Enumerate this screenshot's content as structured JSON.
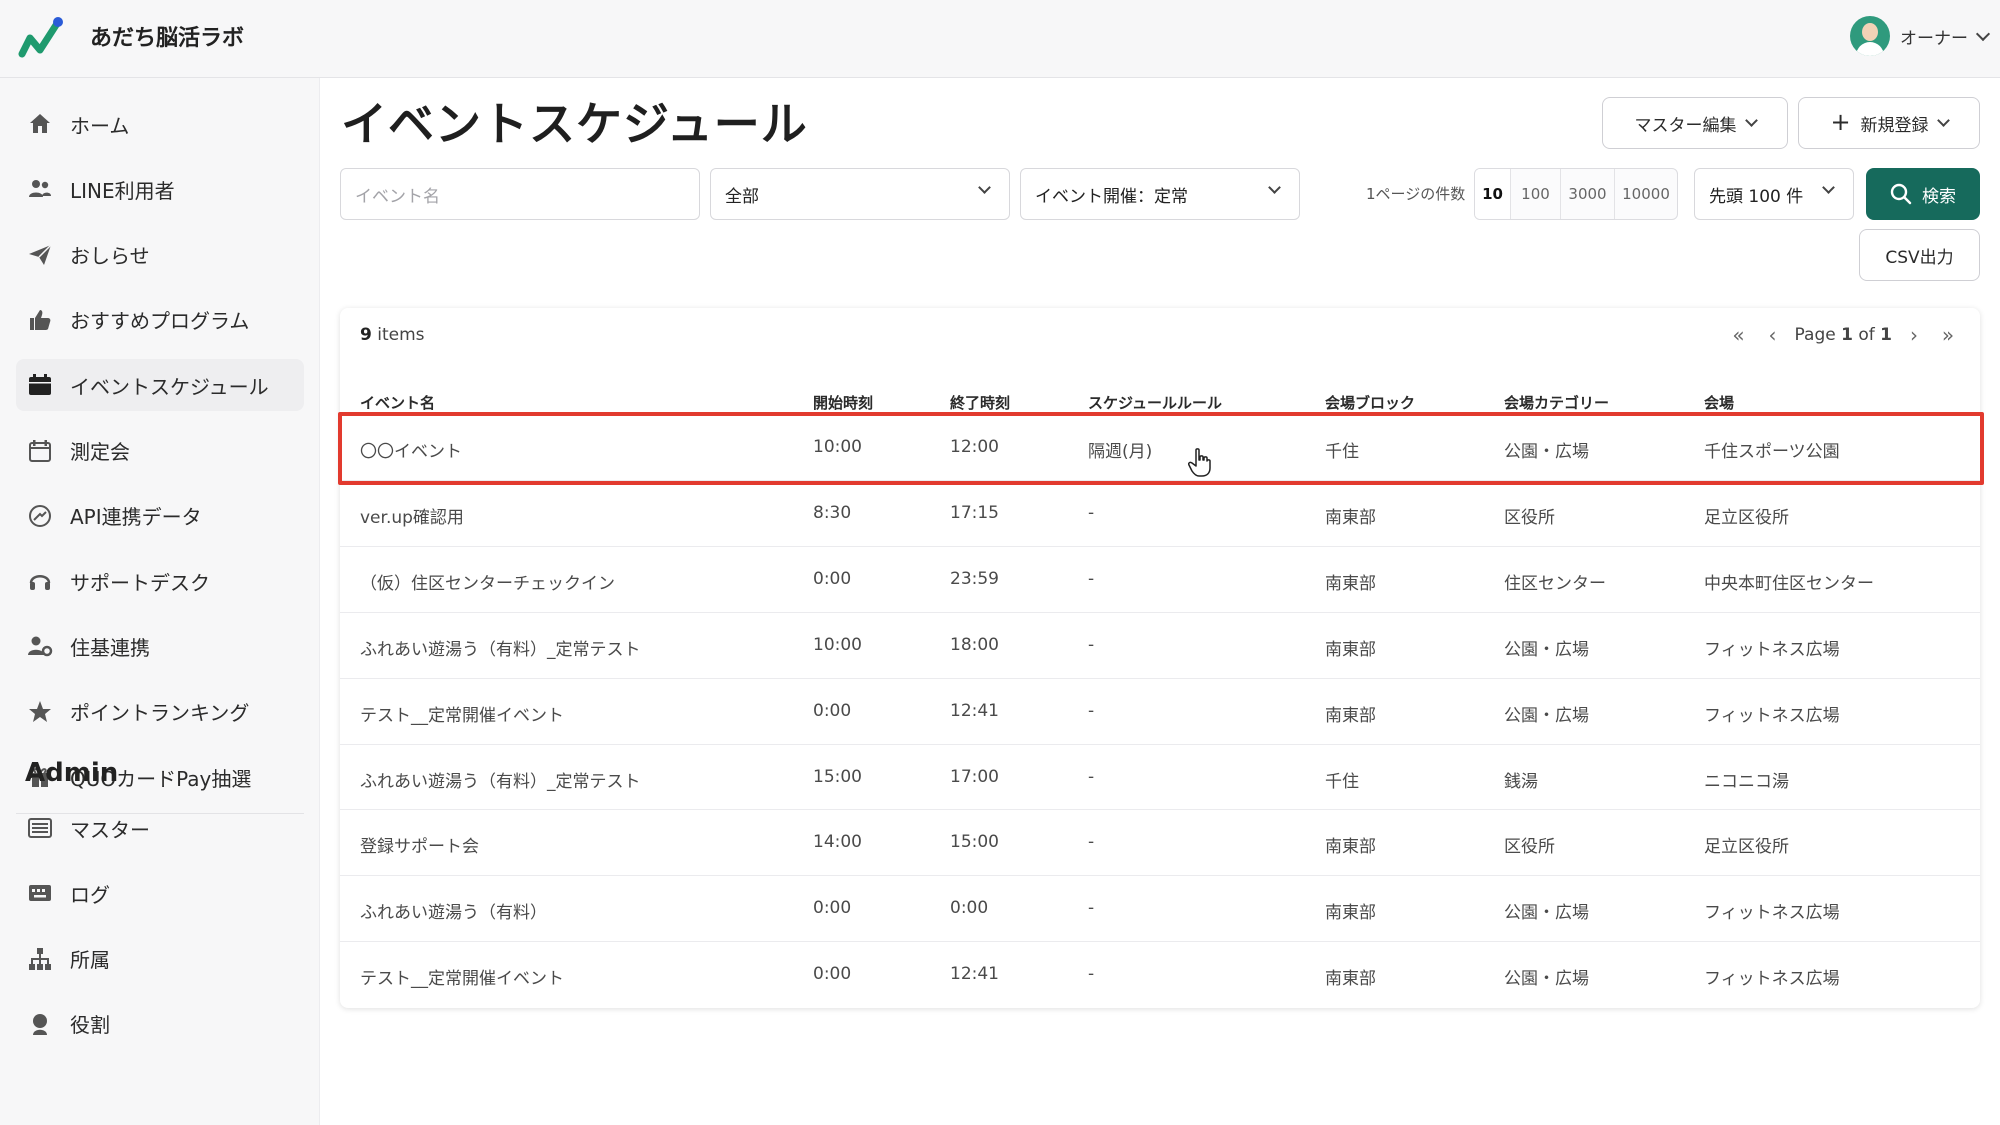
{
  "app": {
    "title": "あだち脳活ラボ"
  },
  "user": {
    "name": "オーナー"
  },
  "sidebar": {
    "items": [
      {
        "label": "ホーム",
        "icon": "home-icon"
      },
      {
        "label": "LINE利用者",
        "icon": "users-icon"
      },
      {
        "label": "おしらせ",
        "icon": "paper-plane-icon"
      },
      {
        "label": "おすすめプログラム",
        "icon": "thumbs-up-icon"
      },
      {
        "label": "イベントスケジュール",
        "icon": "calendar-icon"
      },
      {
        "label": "測定会",
        "icon": "calendar-blank-icon"
      },
      {
        "label": "API連携データ",
        "icon": "api-icon"
      },
      {
        "label": "サポートデスク",
        "icon": "headset-icon"
      },
      {
        "label": "住基連携",
        "icon": "user-settings-icon"
      },
      {
        "label": "ポイントランキング",
        "icon": "star-icon"
      },
      {
        "label": "QUOカードPay抽選",
        "icon": "gift-icon"
      }
    ],
    "admin_heading": "Admin",
    "admin_items": [
      {
        "label": "マスター",
        "icon": "list-icon"
      },
      {
        "label": "ログ",
        "icon": "keyboard-icon"
      },
      {
        "label": "所属",
        "icon": "org-chart-icon"
      },
      {
        "label": "役割",
        "icon": "user-icon"
      }
    ],
    "active_index": 4
  },
  "main": {
    "title": "イベントスケジュール",
    "master_edit_label": "マスター編集",
    "new_label": "新規登録",
    "filters": {
      "event_name_placeholder": "イベント名",
      "category_value": "全部",
      "schedule_value": "イベント開催：定常",
      "per_page_label": "1ページの件数",
      "per_page_options": [
        "10",
        "100",
        "3000",
        "10000"
      ],
      "per_page_selected": "10",
      "range_value": "先頭 100 件"
    },
    "search_label": "検索",
    "csv_label": "CSV出力"
  },
  "table": {
    "items_count": "9",
    "items_suffix": "items",
    "page_prefix": "Page",
    "page_current": "1",
    "page_of": "of",
    "page_total": "1",
    "columns": [
      "イベント名",
      "開始時刻",
      "終了時刻",
      "スケジュールルール",
      "会場ブロック",
      "会場カテゴリー",
      "会場"
    ],
    "rows": [
      [
        "〇〇イベント",
        "10:00",
        "12:00",
        "隔週(月)",
        "千住",
        "公園・広場",
        "千住スポーツ公園"
      ],
      [
        "ver.up確認用",
        "8:30",
        "17:15",
        "-",
        "南東部",
        "区役所",
        "足立区役所"
      ],
      [
        "（仮）住区センターチェックイン",
        "0:00",
        "23:59",
        "-",
        "南東部",
        "住区センター",
        "中央本町住区センター"
      ],
      [
        "ふれあい遊湯う（有料）_定常テスト",
        "10:00",
        "18:00",
        "-",
        "南東部",
        "公園・広場",
        "フィットネス広場"
      ],
      [
        "テスト__定常開催イベント",
        "0:00",
        "12:41",
        "-",
        "南東部",
        "公園・広場",
        "フィットネス広場"
      ],
      [
        "ふれあい遊湯う（有料）_定常テスト",
        "15:00",
        "17:00",
        "-",
        "千住",
        "銭湯",
        "ニコニコ湯"
      ],
      [
        "登録サポート会",
        "14:00",
        "15:00",
        "-",
        "南東部",
        "区役所",
        "足立区役所"
      ],
      [
        "ふれあい遊湯う（有料）",
        "0:00",
        "0:00",
        "-",
        "南東部",
        "公園・広場",
        "フィットネス広場"
      ],
      [
        "テスト__定常開催イベント",
        "0:00",
        "12:41",
        "-",
        "南東部",
        "公園・広場",
        "フィットネス広場"
      ]
    ]
  },
  "colors": {
    "primary": "#166a5c",
    "highlight": "#e23a2e"
  }
}
